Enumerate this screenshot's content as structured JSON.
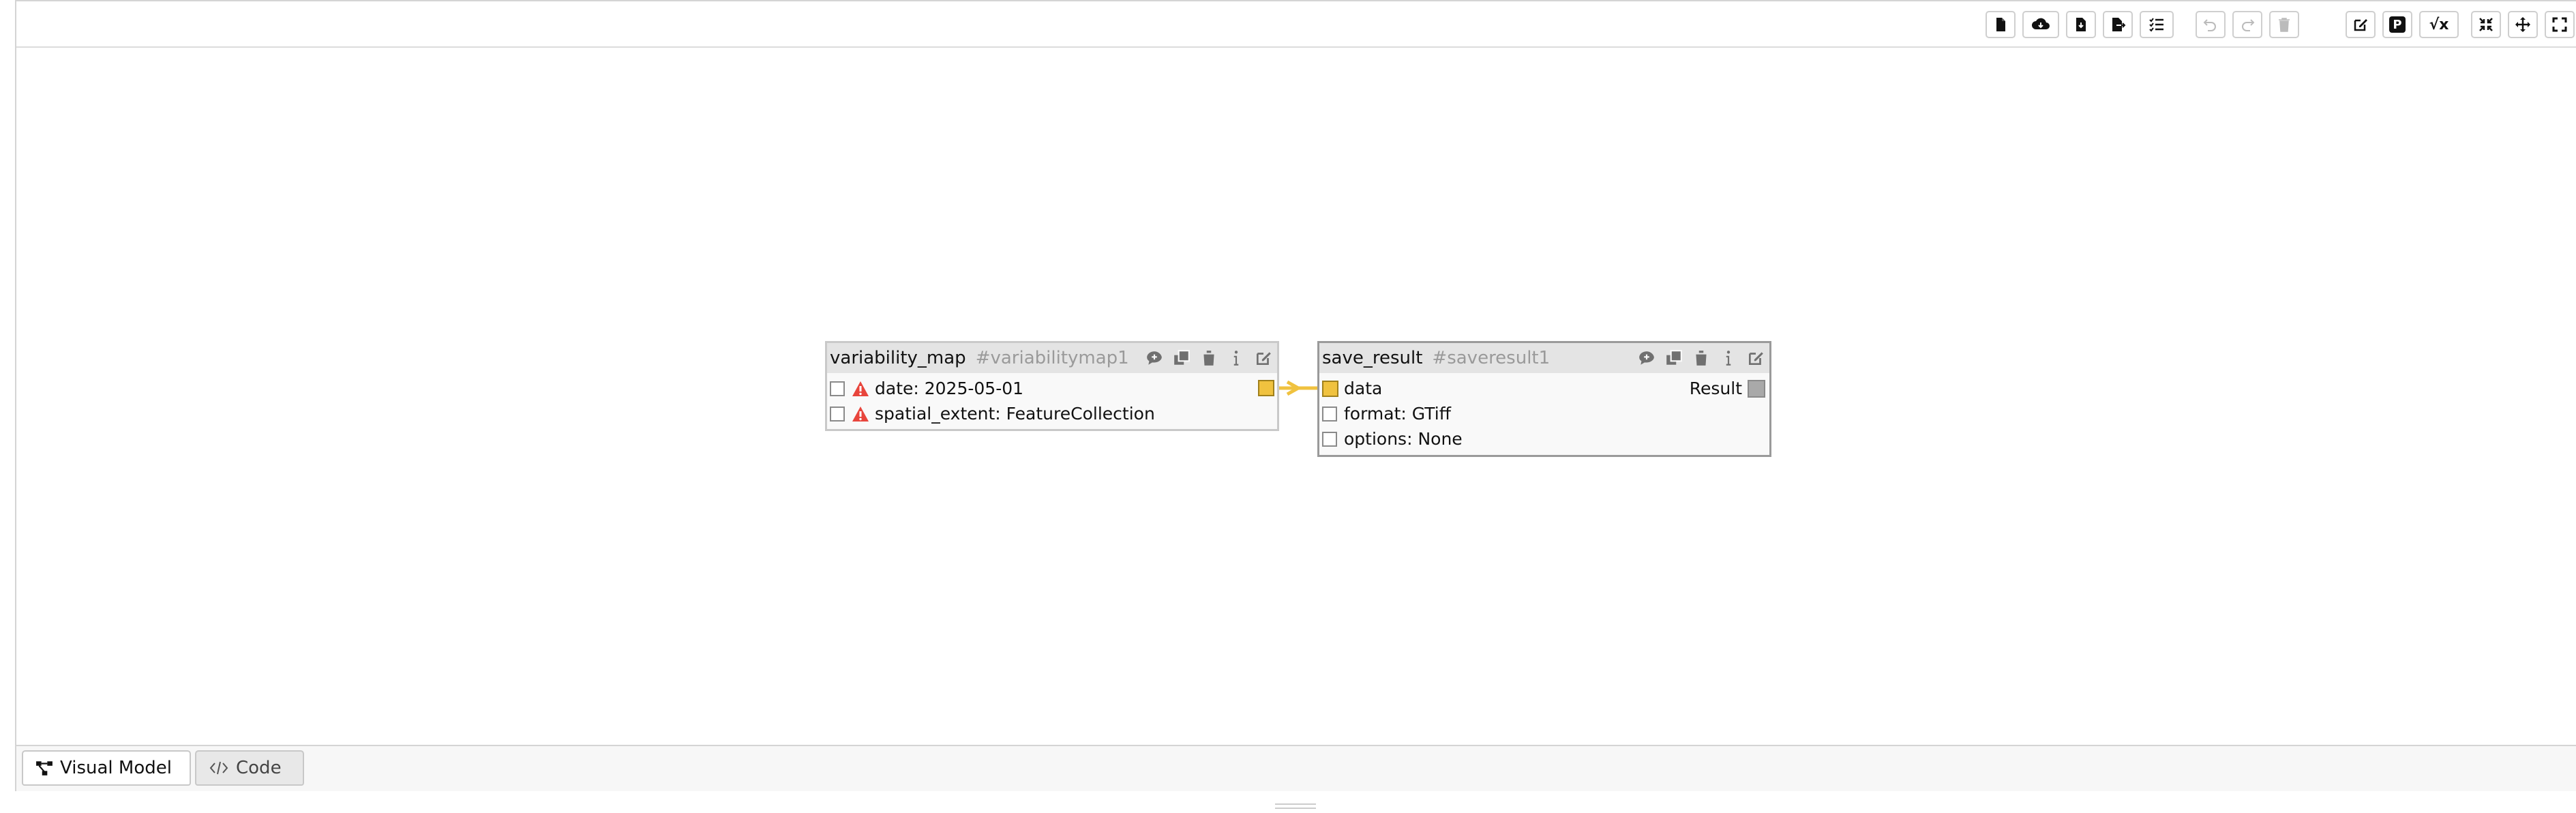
{
  "toolbar": {
    "groups": [
      {
        "buttons": [
          {
            "icon": "new-file-icon"
          },
          {
            "icon": "cloud-download-icon"
          },
          {
            "icon": "file-import-icon"
          },
          {
            "icon": "file-export-icon"
          },
          {
            "icon": "task-list-icon"
          }
        ]
      },
      {
        "buttons": [
          {
            "icon": "undo-icon",
            "disabled": true
          },
          {
            "icon": "redo-icon",
            "disabled": true
          },
          {
            "icon": "trash-icon",
            "disabled": true
          }
        ]
      },
      {
        "buttons": [
          {
            "icon": "edit-icon"
          },
          {
            "icon": "parameter-icon",
            "text": "P"
          },
          {
            "icon": "formula-icon",
            "text": "√x"
          }
        ]
      },
      {
        "buttons": [
          {
            "icon": "compress-icon"
          },
          {
            "icon": "move-icon"
          },
          {
            "icon": "fullscreen-icon"
          }
        ]
      }
    ]
  },
  "nodes": [
    {
      "title": "variability_map",
      "id": "#variabilitymap1",
      "args": [
        {
          "label": "date: 2025-05-01",
          "warning": true
        },
        {
          "label": "spatial_extent: FeatureCollection",
          "warning": true
        }
      ]
    },
    {
      "title": "save_result",
      "id": "#saveresult1",
      "input_label": "data",
      "result_label": "Result",
      "args": [
        {
          "label": "format: GTiff"
        },
        {
          "label": "options: None"
        }
      ]
    }
  ],
  "tabs": [
    {
      "label": "Visual Model",
      "active": true,
      "icon": "graph-icon"
    },
    {
      "label": "Code",
      "active": false,
      "icon": "code-icon"
    }
  ],
  "colors": {
    "port_color": "#f0c23f",
    "edge_color": "#f0c23f",
    "warning_color": "#e8453c"
  }
}
